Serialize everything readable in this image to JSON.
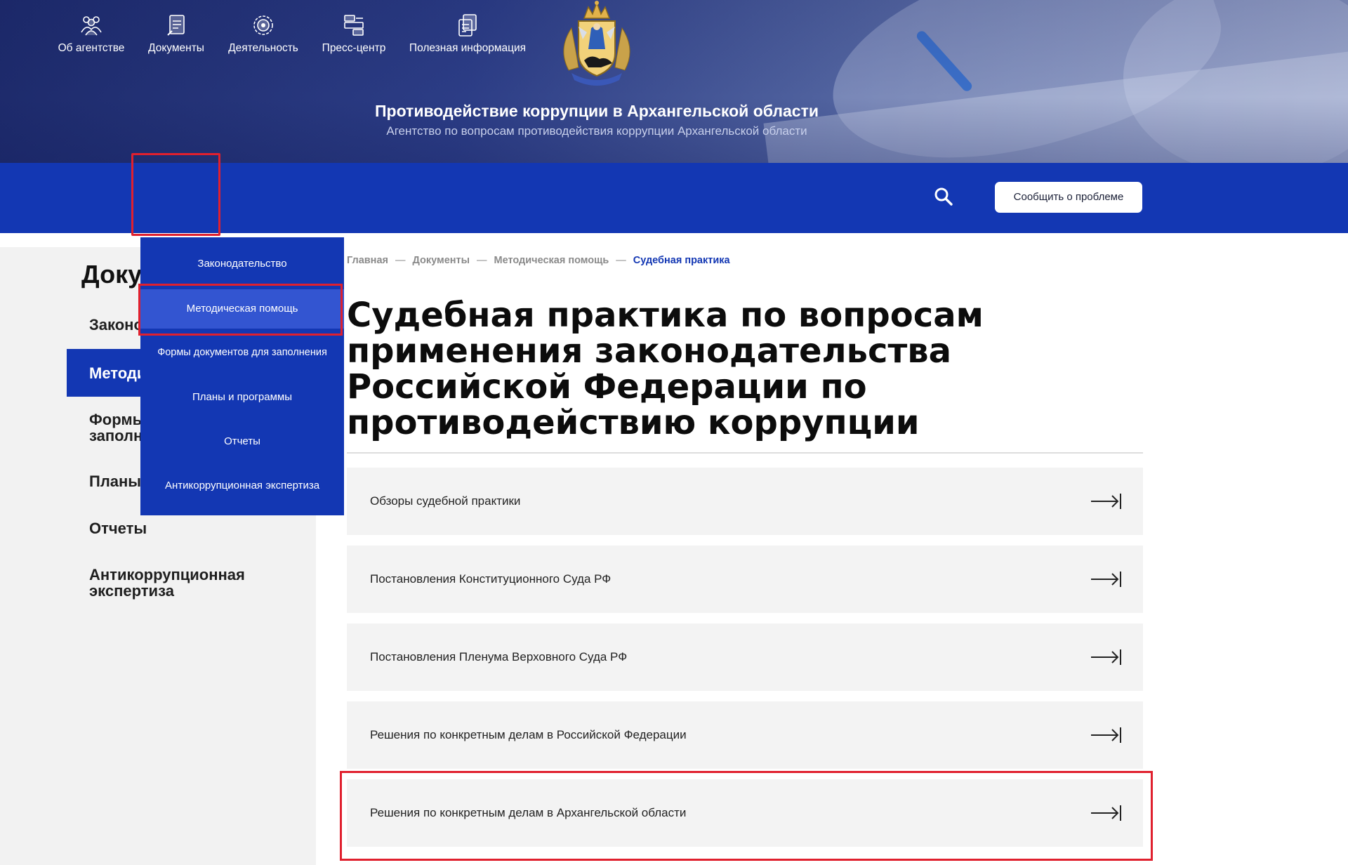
{
  "header": {
    "title": "Противодействие коррупции в Архангельской области",
    "subtitle": "Агентство по вопросам противодействия коррупции Архангельской области",
    "crest_icon": "coat-of-arms-icon"
  },
  "nav": {
    "items": [
      {
        "label": "Об агентстве",
        "icon": "people-icon"
      },
      {
        "label": "Документы",
        "icon": "document-icon"
      },
      {
        "label": "Деятельность",
        "icon": "activity-gear-icon"
      },
      {
        "label": "Пресс-центр",
        "icon": "press-center-icon"
      },
      {
        "label": "Полезная информация",
        "icon": "info-docs-icon"
      }
    ],
    "search_icon": "search-icon",
    "report_button": "Сообщить о проблеме"
  },
  "dropdown": {
    "items": [
      "Законодательство",
      "Методическая помощь",
      "Формы документов для заполнения",
      "Планы и программы",
      "Отчеты",
      "Антикоррупционная экспертиза"
    ],
    "active_index": 1
  },
  "sidebar": {
    "title": "Доку",
    "items": [
      {
        "label": "Законо"
      },
      {
        "label": "Методи",
        "active": true
      },
      {
        "label": "Формы заполн"
      },
      {
        "label": "Планы"
      },
      {
        "label": "Отчеты"
      },
      {
        "label": "Антикоррупционная экспертиза"
      }
    ],
    "forms_line1": "Формы",
    "forms_line2": "заполн",
    "anti_line1": "Антикоррупционная",
    "anti_line2": "экспертиза"
  },
  "breadcrumb": [
    "Главная",
    "Документы",
    "Методическая помощь",
    "Судебная практика"
  ],
  "page": {
    "title": "Судебная практика по вопросам применения законодательства Российской Федерации по противодействию коррупции"
  },
  "list": [
    "Обзоры судебной практики",
    "Постановления Конституционного Суда РФ",
    "Постановления Пленума Верховного Суда РФ",
    "Решения по конкретным делам в Российской Федерации",
    "Решения по конкретным делам в Архангельской области"
  ],
  "colors": {
    "brand_blue": "#1337b3",
    "highlight_red": "#e0202e",
    "row_bg": "#f3f3f3",
    "sidebar_bg": "#f2f2f2"
  }
}
